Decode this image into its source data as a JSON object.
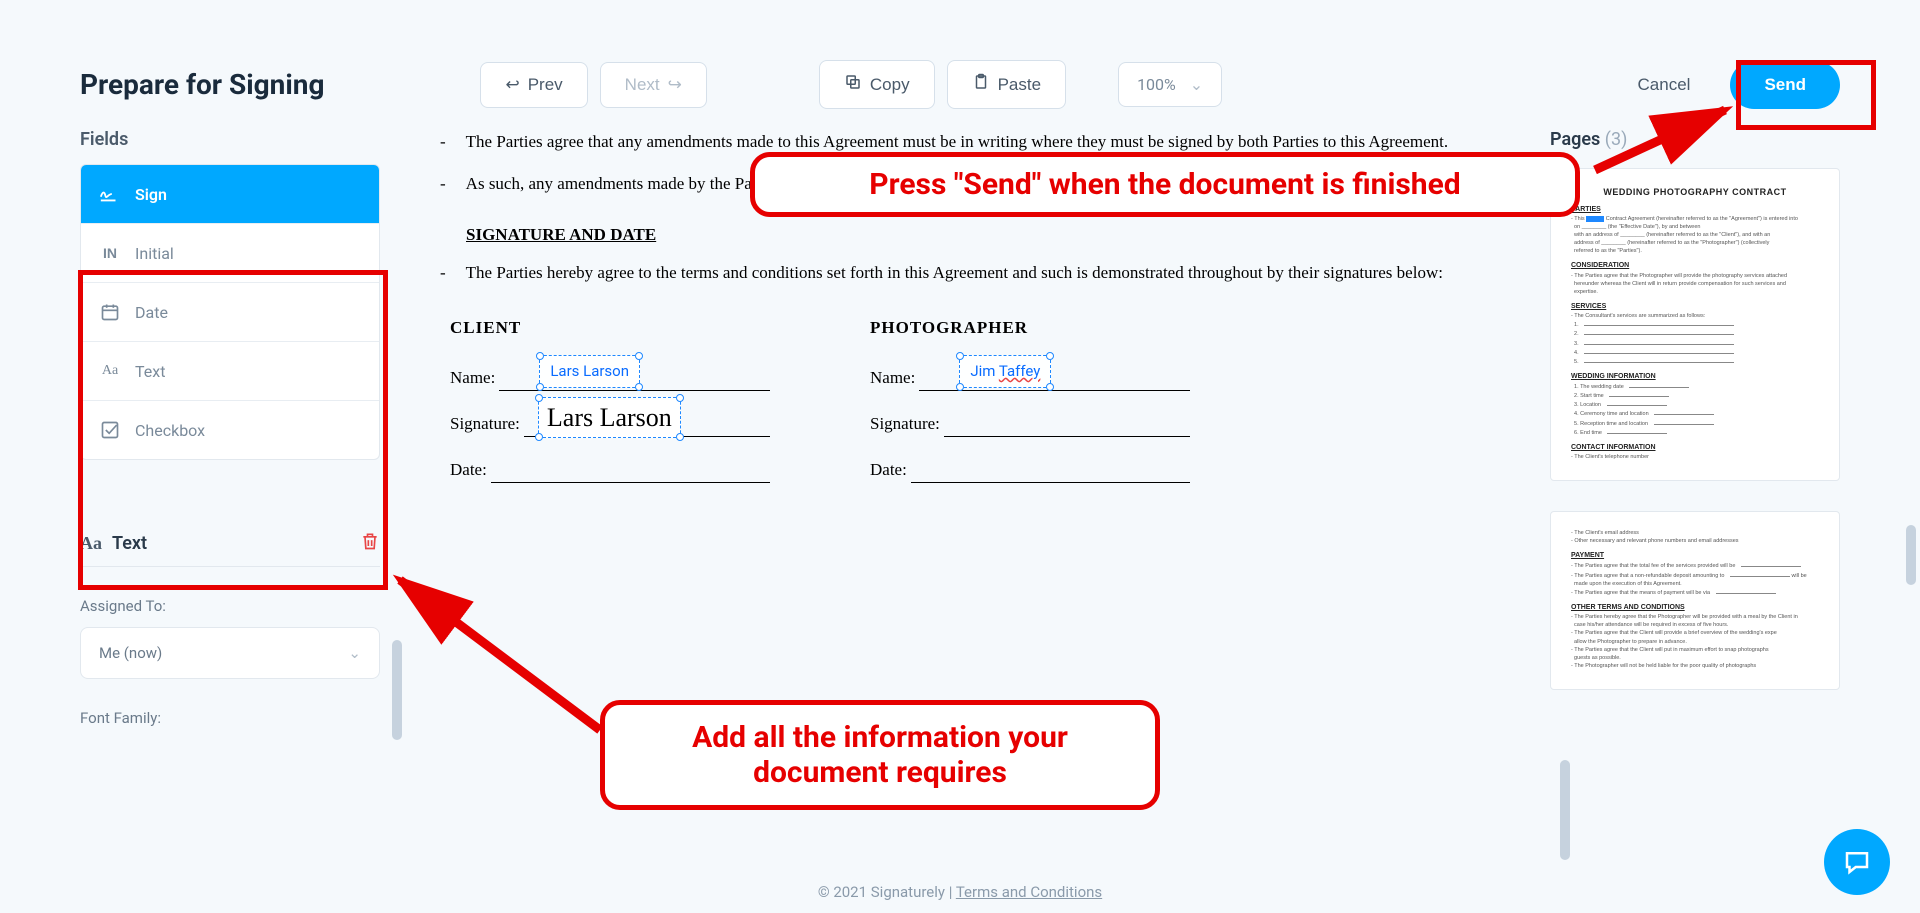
{
  "header": {
    "title": "Prepare for Signing",
    "prev": "Prev",
    "next": "Next",
    "copy": "Copy",
    "paste": "Paste",
    "zoom": "100%",
    "cancel": "Cancel",
    "send": "Send"
  },
  "annotations": {
    "send_hint": "Press \"Send\" when the document is finished",
    "fields_hint": "Add all the information your document requires"
  },
  "fields": {
    "heading": "Fields",
    "items": [
      {
        "label": "Sign"
      },
      {
        "label": "Initial"
      },
      {
        "label": "Date"
      },
      {
        "label": "Text"
      },
      {
        "label": "Checkbox"
      }
    ]
  },
  "text_panel": {
    "title": "Text",
    "assigned_label": "Assigned To:",
    "assigned_value": "Me (now)",
    "font_family_label": "Font Family:"
  },
  "document": {
    "para1": "The Parties agree that any amendments made to this Agreement must be in writing where they must be signed by both Parties to this Agreement.",
    "para2": "As such, any amendments made by the Parties will be applied to this Agreement.",
    "sig_head": "SIGNATURE AND DATE",
    "para3": "The Parties hereby agree to the terms and conditions set forth in this Agreement and such is demonstrated throughout by their signatures below:",
    "client_title": "CLIENT",
    "photog_title": "PHOTOGRAPHER",
    "labels": {
      "name": "Name:",
      "signature": "Signature:",
      "date": "Date:"
    },
    "client_name": "Lars Larson",
    "client_sig": "Lars Larson",
    "photog_name_a": "Jim ",
    "photog_name_b": "Taffey"
  },
  "pages": {
    "heading": "Pages",
    "count": "(3)",
    "thumb1": {
      "title": "WEDDING PHOTOGRAPHY CONTRACT",
      "parties": "PARTIES",
      "consideration": "CONSIDERATION",
      "services": "SERVICES",
      "wedding_info": "WEDDING INFORMATION",
      "contact_info": "CONTACT INFORMATION"
    },
    "thumb2": {
      "payment": "PAYMENT",
      "other": "OTHER TERMS AND CONDITIONS"
    }
  },
  "footer": {
    "copyright": "© 2021 Signaturely | ",
    "terms": "Terms and Conditions"
  }
}
